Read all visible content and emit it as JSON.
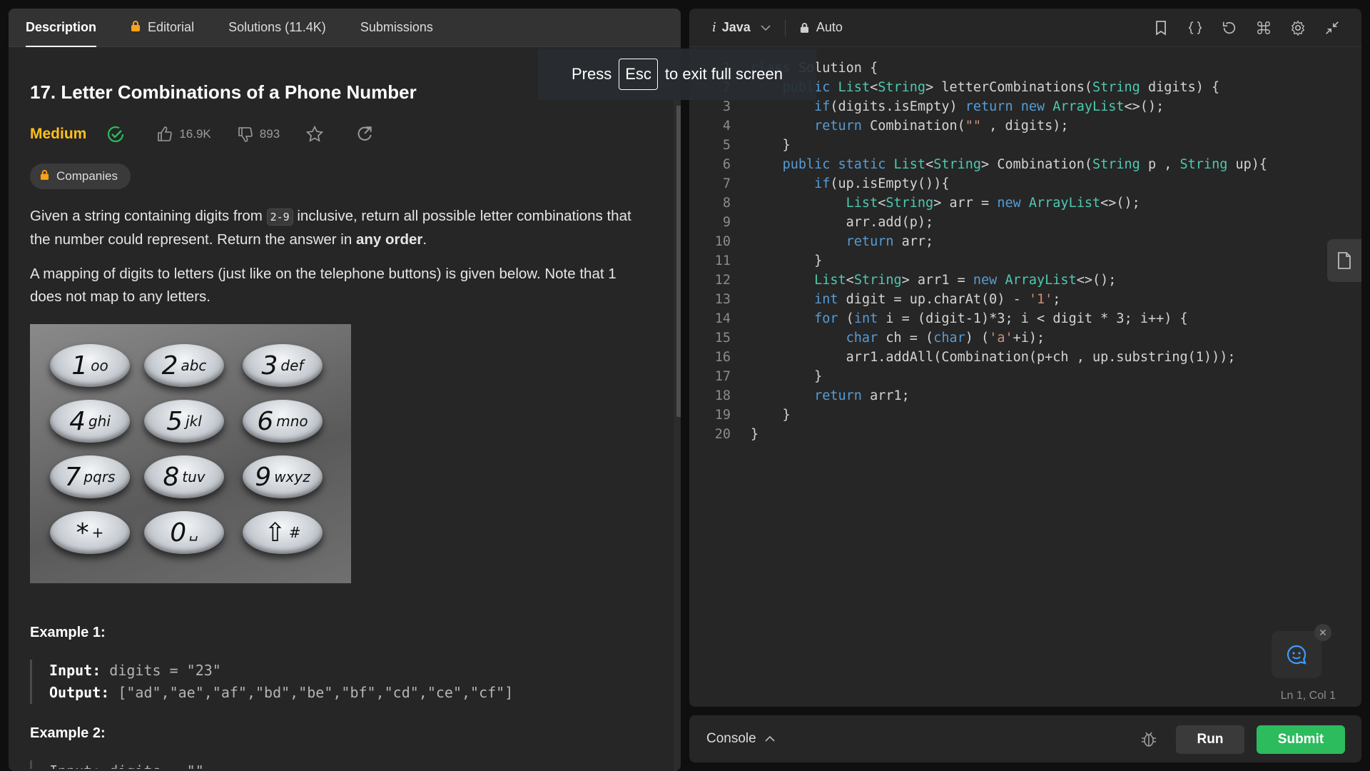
{
  "tabs": [
    "Description",
    "Editorial",
    "Solutions (11.4K)",
    "Submissions"
  ],
  "problem": {
    "title": "17. Letter Combinations of a Phone Number",
    "difficulty": "Medium",
    "likes": "16.9K",
    "dislikes": "893",
    "companies_label": "Companies",
    "para1_a": "Given a string containing digits from ",
    "para1_code": "2-9",
    "para1_b": " inclusive, return all possible letter combinations that the number could represent. Return the answer in ",
    "para1_bold": "any order",
    "para1_c": ".",
    "para2": "A mapping of digits to letters (just like on the telephone buttons) is given below. Note that 1 does not map to any letters.",
    "keys": [
      {
        "n": "1",
        "l": "οο"
      },
      {
        "n": "2",
        "l": "abc"
      },
      {
        "n": "3",
        "l": "def"
      },
      {
        "n": "4",
        "l": "ghi"
      },
      {
        "n": "5",
        "l": "jkl"
      },
      {
        "n": "6",
        "l": "mno"
      },
      {
        "n": "7",
        "l": "pqrs"
      },
      {
        "n": "8",
        "l": "tuv"
      },
      {
        "n": "9",
        "l": "wxyz"
      },
      {
        "n": "*",
        "l": "+"
      },
      {
        "n": "0",
        "l": "␣"
      },
      {
        "n": "⇧",
        "l": "#"
      }
    ],
    "example1_title": "Example 1:",
    "example1_input_label": "Input:",
    "example1_input": "digits = \"23\"",
    "example1_output_label": "Output:",
    "example1_output": "[\"ad\",\"ae\",\"af\",\"bd\",\"be\",\"bf\",\"cd\",\"ce\",\"cf\"]",
    "example2_title": "Example 2:",
    "example2_partial": "Input: digits = \"\""
  },
  "toast": {
    "press": "Press",
    "key": "Esc",
    "rest": "to exit full screen"
  },
  "editor": {
    "language": "Java",
    "mode": "Auto",
    "cursor": "Ln 1, Col 1",
    "lines": [
      "class Solution {",
      "    public List<String> letterCombinations(String digits) {",
      "        if(digits.isEmpty) return new ArrayList<>();",
      "        return Combination(\"\" , digits);",
      "    }",
      "    public static List<String> Combination(String p , String up){",
      "        if(up.isEmpty()){",
      "            List<String> arr = new ArrayList<>();",
      "            arr.add(p);",
      "            return arr;",
      "        }",
      "        List<String> arr1 = new ArrayList<>();",
      "        int digit = up.charAt(0) - '1';",
      "        for (int i = (digit-1)*3; i < digit * 3; i++) {",
      "            char ch = (char) ('a'+i);",
      "            arr1.addAll(Combination(p+ch , up.substring(1)));",
      "        }",
      "        return arr1;",
      "    }",
      "}"
    ]
  },
  "console": {
    "label": "Console",
    "run": "Run",
    "submit": "Submit"
  },
  "colors": {
    "accent_green": "#2cbb5d",
    "difficulty_medium": "#ffc01e",
    "lock_orange": "#ffa116"
  }
}
